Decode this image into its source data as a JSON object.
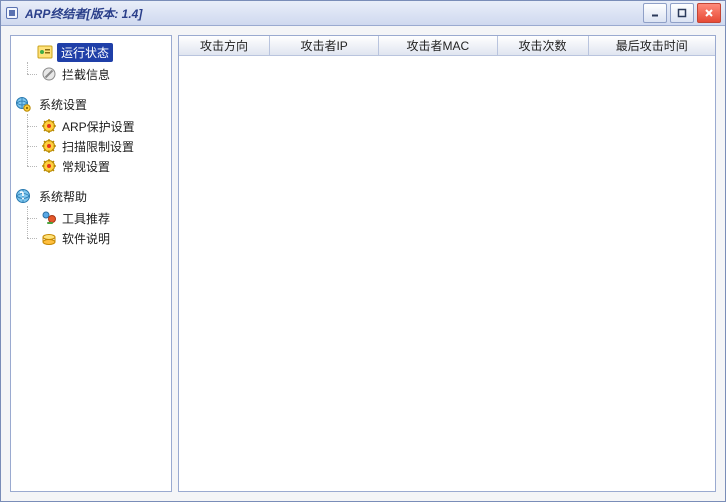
{
  "window": {
    "title": "ARP终结者[版本: 1.4]"
  },
  "sidebar": {
    "groups": [
      {
        "id": "status",
        "icon": "status-icon",
        "label": "运行状态",
        "selected": true,
        "children": [
          {
            "id": "block-info",
            "icon": "block-icon",
            "label": "拦截信息"
          }
        ]
      },
      {
        "id": "settings",
        "icon": "globe-gear-icon",
        "label": "系统设置",
        "selected": false,
        "children": [
          {
            "id": "arp-protect",
            "icon": "gear-star-icon",
            "label": "ARP保护设置"
          },
          {
            "id": "scan-limit",
            "icon": "gear-star-icon",
            "label": "扫描限制设置"
          },
          {
            "id": "general",
            "icon": "gear-star-icon",
            "label": "常规设置"
          }
        ]
      },
      {
        "id": "help",
        "icon": "globe-help-icon",
        "label": "系统帮助",
        "selected": false,
        "children": [
          {
            "id": "tools",
            "icon": "tools-icon",
            "label": "工具推荐"
          },
          {
            "id": "manual",
            "icon": "manual-icon",
            "label": "软件说明"
          }
        ]
      }
    ]
  },
  "table": {
    "columns": [
      {
        "id": "direction",
        "label": "攻击方向"
      },
      {
        "id": "attacker_ip",
        "label": "攻击者IP"
      },
      {
        "id": "attacker_mac",
        "label": "攻击者MAC"
      },
      {
        "id": "count",
        "label": "攻击次数"
      },
      {
        "id": "last_time",
        "label": "最后攻击时间"
      }
    ],
    "rows": []
  }
}
